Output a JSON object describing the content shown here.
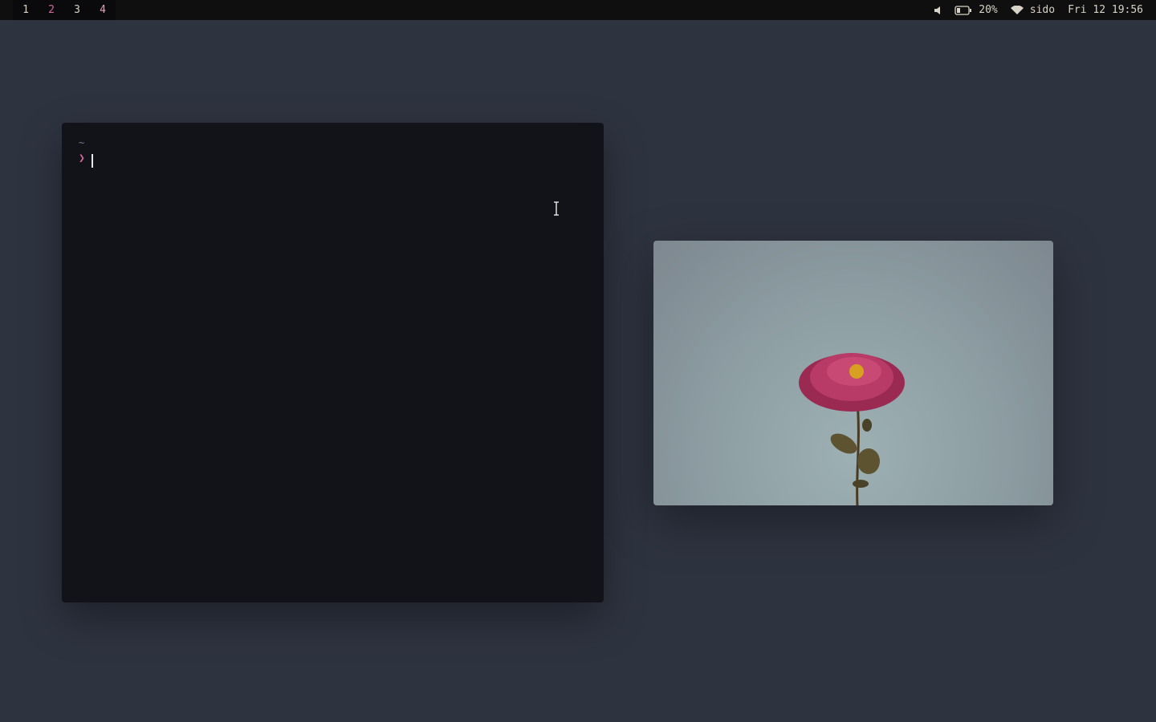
{
  "topbar": {
    "workspaces": [
      {
        "label": "1",
        "color": "#d8d3c8"
      },
      {
        "label": "2",
        "color": "#d46a9c"
      },
      {
        "label": "3",
        "color": "#d8d3c8"
      },
      {
        "label": "4",
        "color": "#e8a0b8"
      }
    ],
    "volume_icon": "speaker-muted-icon",
    "battery_icon": "battery-icon",
    "battery": "20%",
    "wifi_icon": "wifi-icon",
    "network": "sido",
    "clock": "Fri 12 19:56"
  },
  "terminal": {
    "cwd": "~",
    "prompt": "❯"
  },
  "image_viewer": {
    "subject_icon": "flower-photo"
  }
}
